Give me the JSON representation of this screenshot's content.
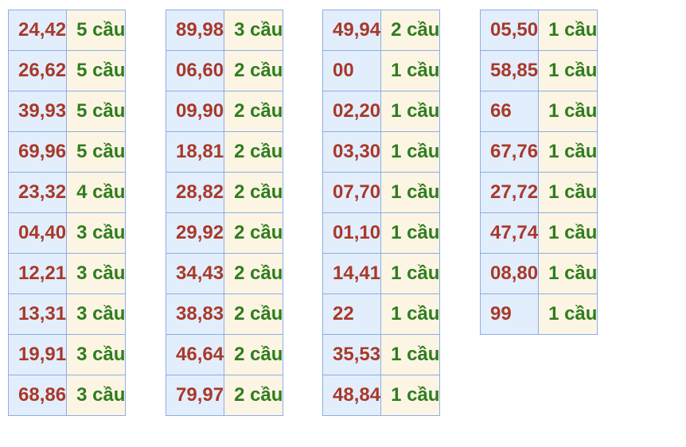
{
  "colors": {
    "pair_text": "#a8392a",
    "count_text": "#2f7d1e",
    "pair_bg": "#e3eefc",
    "count_bg": "#fdf5e3",
    "border": "#8aaee8"
  },
  "columns": [
    {
      "rows": [
        {
          "pair": "24,42",
          "count": "5 cầu"
        },
        {
          "pair": "26,62",
          "count": "5 cầu"
        },
        {
          "pair": "39,93",
          "count": "5 cầu"
        },
        {
          "pair": "69,96",
          "count": "5 cầu"
        },
        {
          "pair": "23,32",
          "count": "4 cầu"
        },
        {
          "pair": "04,40",
          "count": "3 cầu"
        },
        {
          "pair": "12,21",
          "count": "3 cầu"
        },
        {
          "pair": "13,31",
          "count": "3 cầu"
        },
        {
          "pair": "19,91",
          "count": "3 cầu"
        },
        {
          "pair": "68,86",
          "count": "3 cầu"
        }
      ]
    },
    {
      "rows": [
        {
          "pair": "89,98",
          "count": "3 cầu"
        },
        {
          "pair": "06,60",
          "count": "2 cầu"
        },
        {
          "pair": "09,90",
          "count": "2 cầu"
        },
        {
          "pair": "18,81",
          "count": "2 cầu"
        },
        {
          "pair": "28,82",
          "count": "2 cầu"
        },
        {
          "pair": "29,92",
          "count": "2 cầu"
        },
        {
          "pair": "34,43",
          "count": "2 cầu"
        },
        {
          "pair": "38,83",
          "count": "2 cầu"
        },
        {
          "pair": "46,64",
          "count": "2 cầu"
        },
        {
          "pair": "79,97",
          "count": "2 cầu"
        }
      ]
    },
    {
      "rows": [
        {
          "pair": "49,94",
          "count": "2 cầu"
        },
        {
          "pair": "00",
          "count": "1 cầu"
        },
        {
          "pair": "02,20",
          "count": "1 cầu"
        },
        {
          "pair": "03,30",
          "count": "1 cầu"
        },
        {
          "pair": "07,70",
          "count": "1 cầu"
        },
        {
          "pair": "01,10",
          "count": "1 cầu"
        },
        {
          "pair": "14,41",
          "count": "1 cầu"
        },
        {
          "pair": "22",
          "count": "1 cầu"
        },
        {
          "pair": "35,53",
          "count": "1 cầu"
        },
        {
          "pair": "48,84",
          "count": "1 cầu"
        }
      ]
    },
    {
      "rows": [
        {
          "pair": "05,50",
          "count": "1 cầu"
        },
        {
          "pair": "58,85",
          "count": "1 cầu"
        },
        {
          "pair": "66",
          "count": "1 cầu"
        },
        {
          "pair": "67,76",
          "count": "1 cầu"
        },
        {
          "pair": "27,72",
          "count": "1 cầu"
        },
        {
          "pair": "47,74",
          "count": "1 cầu"
        },
        {
          "pair": "08,80",
          "count": "1 cầu"
        },
        {
          "pair": "99",
          "count": "1 cầu"
        }
      ]
    }
  ]
}
